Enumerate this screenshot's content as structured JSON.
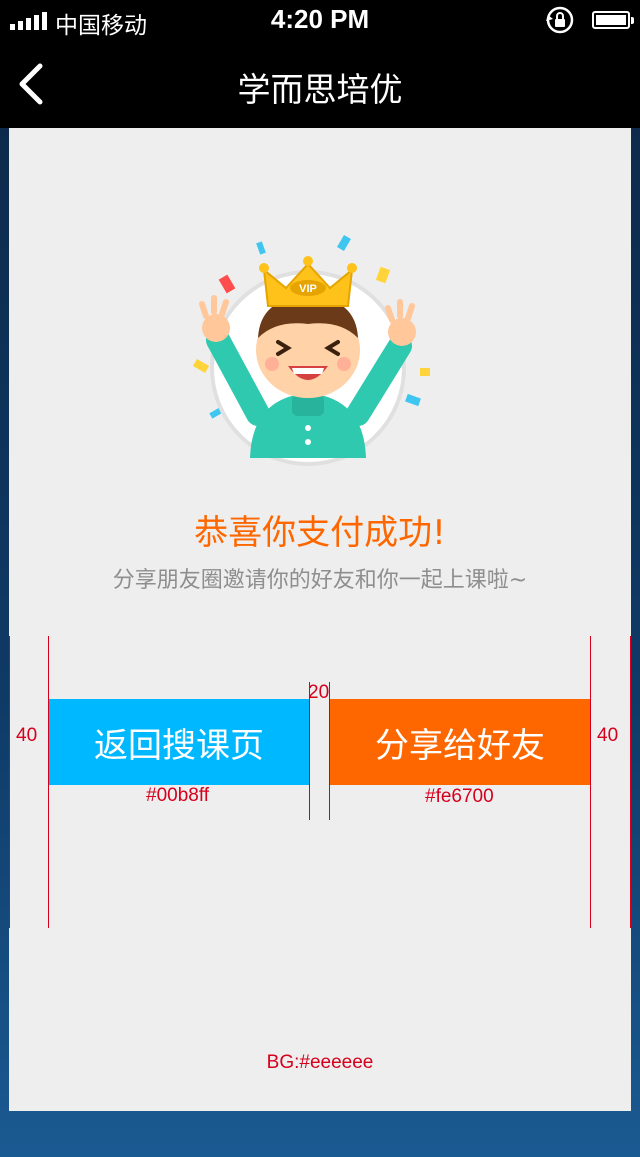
{
  "status_bar": {
    "carrier": "中国移动",
    "time": "4:20 PM"
  },
  "navbar": {
    "title": "学而思培优"
  },
  "success": {
    "headline": "恭喜你支付成功!",
    "subline": "分享朋友圈邀请你的好友和你一起上课啦~"
  },
  "buttons": {
    "back_label": "返回搜课页",
    "share_label": "分享给好友"
  },
  "annotations": {
    "left_margin": "40",
    "right_margin": "40",
    "gap": "20",
    "back_color": "#00b8ff",
    "share_color": "#fe6700",
    "bg_color": "BG:#eeeeee"
  },
  "avatar": {
    "badge": "VIP"
  },
  "colors": {
    "accent_blue": "#00b8ff",
    "accent_orange": "#fe6700",
    "background": "#eeeeee",
    "annotation_red": "#d6001c"
  }
}
